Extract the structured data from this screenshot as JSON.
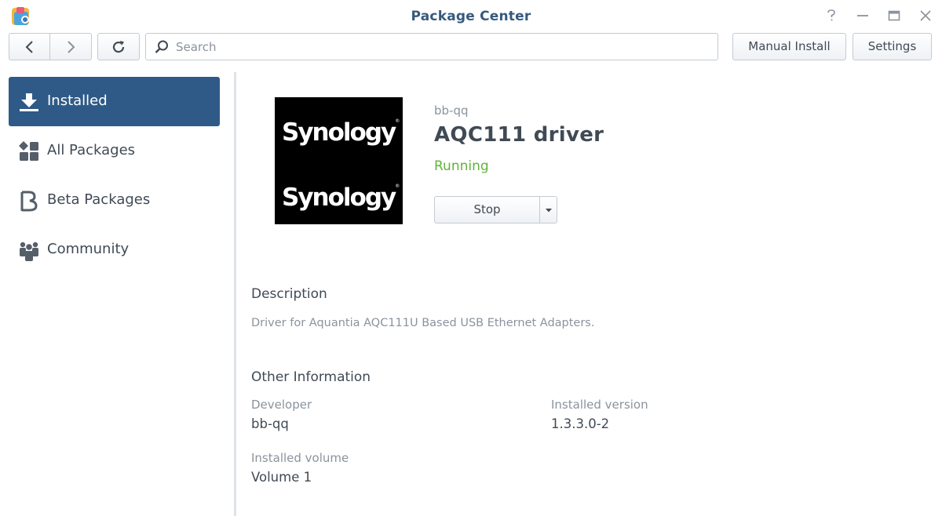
{
  "window": {
    "title": "Package Center",
    "help_symbol": "?"
  },
  "toolbar": {
    "search_placeholder": "Search",
    "manual_install_label": "Manual Install",
    "settings_label": "Settings"
  },
  "sidebar": {
    "items": [
      {
        "label": "Installed",
        "icon": "download-icon",
        "active": true
      },
      {
        "label": "All Packages",
        "icon": "grid-icon",
        "active": false
      },
      {
        "label": "Beta Packages",
        "icon": "beta-icon",
        "active": false
      },
      {
        "label": "Community",
        "icon": "people-icon",
        "active": false
      }
    ]
  },
  "package": {
    "logo_text": [
      "Synology",
      "Synology"
    ],
    "logo_trademark": "®",
    "developer_small": "bb-qq",
    "name": "AQC111 driver",
    "status": "Running",
    "action_label": "Stop"
  },
  "description": {
    "title": "Description",
    "text": "Driver for Aquantia AQC111U Based USB Ethernet Adapters."
  },
  "other_information": {
    "title": "Other Information",
    "developer_label": "Developer",
    "developer_value": "bb-qq",
    "version_label": "Installed version",
    "version_value": "1.3.3.0-2",
    "volume_label": "Installed volume",
    "volume_value": "Volume 1"
  },
  "colors": {
    "accent": "#2f5a87",
    "title": "#365a7d",
    "status_running": "#62b33c",
    "text": "#404a55",
    "muted": "#8a939d"
  }
}
